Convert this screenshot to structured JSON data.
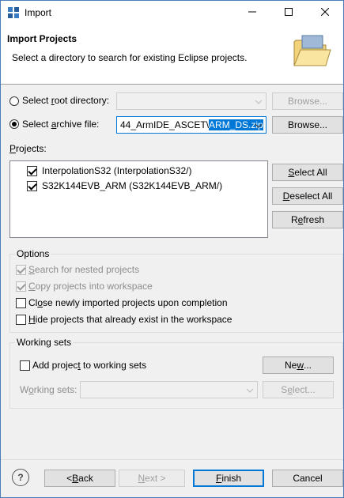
{
  "window": {
    "title": "Import"
  },
  "header": {
    "title": "Import Projects",
    "description": "Select a directory to search for existing Eclipse projects."
  },
  "source": {
    "root_directory_label_pre": "Select ",
    "root_directory_label_u": "r",
    "root_directory_label_post": "oot directory:",
    "root_directory_value": "",
    "root_browse_label": "Browse...",
    "archive_label_pre": "Select ",
    "archive_label_u": "a",
    "archive_label_post": "rchive file:",
    "archive_value_plain": "44_ArmIDE_ASCET\\",
    "archive_value_selected": "ARM_DS.zip",
    "archive_browse_label": "Browse...",
    "selected_option": "archive"
  },
  "projects": {
    "label_u": "P",
    "label_post": "rojects:",
    "items": [
      {
        "label": "InterpolationS32 (InterpolationS32/)",
        "checked": true
      },
      {
        "label": "S32K144EVB_ARM (S32K144EVB_ARM/)",
        "checked": true
      }
    ],
    "select_all_u": "S",
    "select_all_post": "elect All",
    "deselect_all_u": "D",
    "deselect_all_post": "eselect All",
    "refresh_pre": "R",
    "refresh_u": "e",
    "refresh_post": "fresh"
  },
  "options": {
    "legend": "Options",
    "search_nested_u": "S",
    "search_nested_post": "earch for nested projects",
    "copy_u": "C",
    "copy_post": "opy projects into workspace",
    "close_pre": "Cl",
    "close_u": "o",
    "close_post": "se newly imported projects upon completion",
    "hide_u": "H",
    "hide_post": "ide projects that already exist in the workspace"
  },
  "working_sets": {
    "legend": "Working sets",
    "add_label_pre": "Add projec",
    "add_label_u": "t",
    "add_label_post": " to working sets",
    "new_pre": "Ne",
    "new_u": "w",
    "new_post": "...",
    "sets_label_pre": "W",
    "sets_label_u": "o",
    "sets_label_post": "rking sets:",
    "select_pre": "S",
    "select_u": "e",
    "select_post": "lect..."
  },
  "footer": {
    "help": "?",
    "back_pre": "< ",
    "back_u": "B",
    "back_post": "ack",
    "next_u": "N",
    "next_post": "ext >",
    "finish_u": "F",
    "finish_post": "inish",
    "cancel": "Cancel"
  },
  "colors": {
    "accent": "#0078d7",
    "window_border": "#4a7ebb"
  }
}
